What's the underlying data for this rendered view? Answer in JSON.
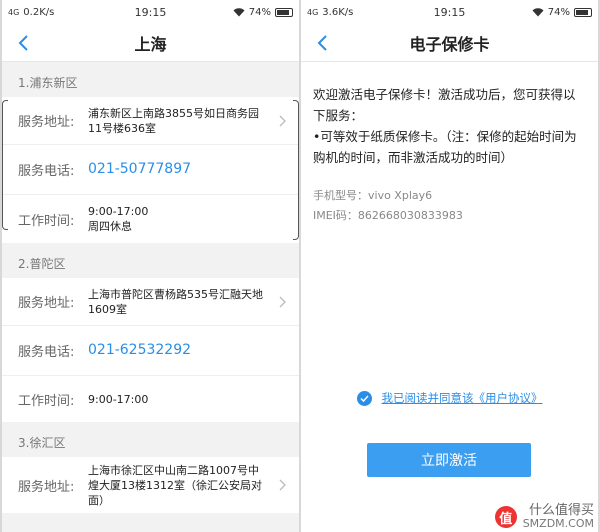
{
  "left": {
    "status": {
      "net": "4G",
      "speed": "0.2K/s",
      "time": "19:15",
      "battery": "74%"
    },
    "title": "上海",
    "sections": [
      {
        "label": "1.浦东新区",
        "address_label": "服务地址:",
        "address": "浦东新区上南路3855号如日商务园11号楼636室",
        "phone_label": "服务电话:",
        "phone": "021-50777897",
        "hours_label": "工作时间:",
        "hours": "9:00-17:00",
        "hours_note": "周四休息"
      },
      {
        "label": "2.普陀区",
        "address_label": "服务地址:",
        "address": "上海市普陀区曹杨路535号汇融天地1609室",
        "phone_label": "服务电话:",
        "phone": "021-62532292",
        "hours_label": "工作时间:",
        "hours": "9:00-17:00"
      },
      {
        "label": "3.徐汇区",
        "address_label": "服务地址:",
        "address": "上海市徐汇区中山南二路1007号中煌大厦13楼1312室（徐汇公安局对面）"
      }
    ]
  },
  "right": {
    "status": {
      "net": "4G",
      "speed": "3.6K/s",
      "time": "19:15",
      "battery": "74%"
    },
    "title": "电子保修卡",
    "intro_line1": "欢迎激活电子保修卡！激活成功后，您可获得以下服务：",
    "intro_line2": "•可等效于纸质保修卡。（注：保修的起始时间为购机的时间，而非激活成功的时间）",
    "model": "手机型号：vivo Xplay6",
    "imei": "IMEI码：862668030833983",
    "agree_text": "我已阅读并同意该《用户协议》",
    "activate_button": "立即激活"
  },
  "watermark": {
    "icon_text": "值",
    "line1": "什么值得买",
    "line2": "SMZDM.COM"
  }
}
